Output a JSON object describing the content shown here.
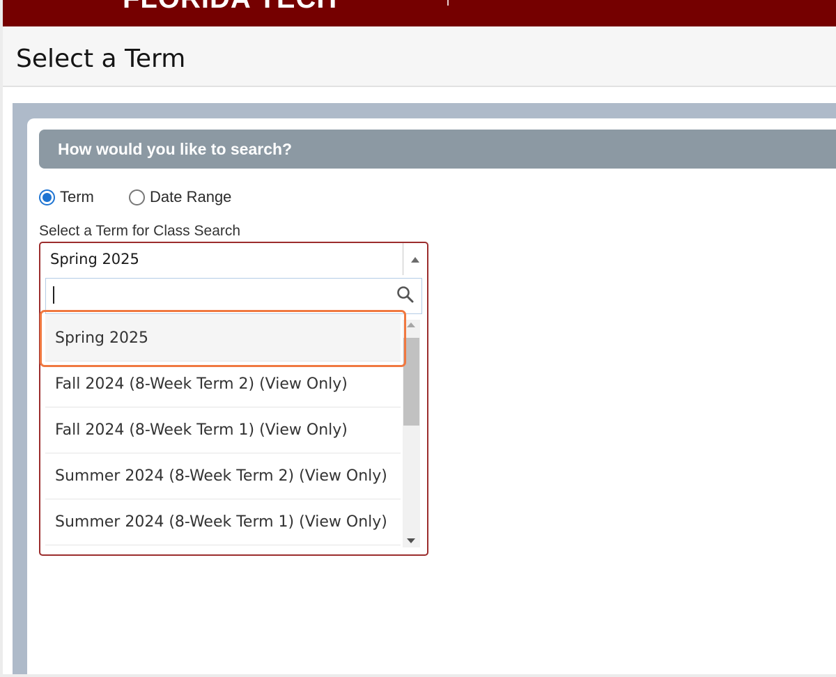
{
  "banner": {
    "logo_text": "FLORIDA TECH",
    "color": "#750000"
  },
  "page": {
    "title": "Select a Term"
  },
  "search_panel": {
    "header": "How would you like to search?",
    "radios": [
      {
        "label": "Term",
        "checked": true
      },
      {
        "label": "Date Range",
        "checked": false
      }
    ],
    "term_select": {
      "label": "Select a Term for Class Search",
      "selected": "Spring 2025",
      "search_value": "",
      "search_icon": "magnifier-icon",
      "expanded": true,
      "options": [
        "Spring 2025",
        "Fall 2024 (8-Week Term 2) (View Only)",
        "Fall 2024 (8-Week Term 1) (View Only)",
        "Summer 2024 (8-Week Term 2) (View Only)",
        "Summer 2024 (8-Week Term 1) (View Only)"
      ],
      "highlighted_option": "Spring 2025"
    }
  },
  "colors": {
    "radio_checked": "#1e74d2",
    "highlight_outline": "#f07840",
    "select_border": "#9b2c2c",
    "header_bar": "#8c99a3",
    "panel_bg": "#aebac9"
  }
}
